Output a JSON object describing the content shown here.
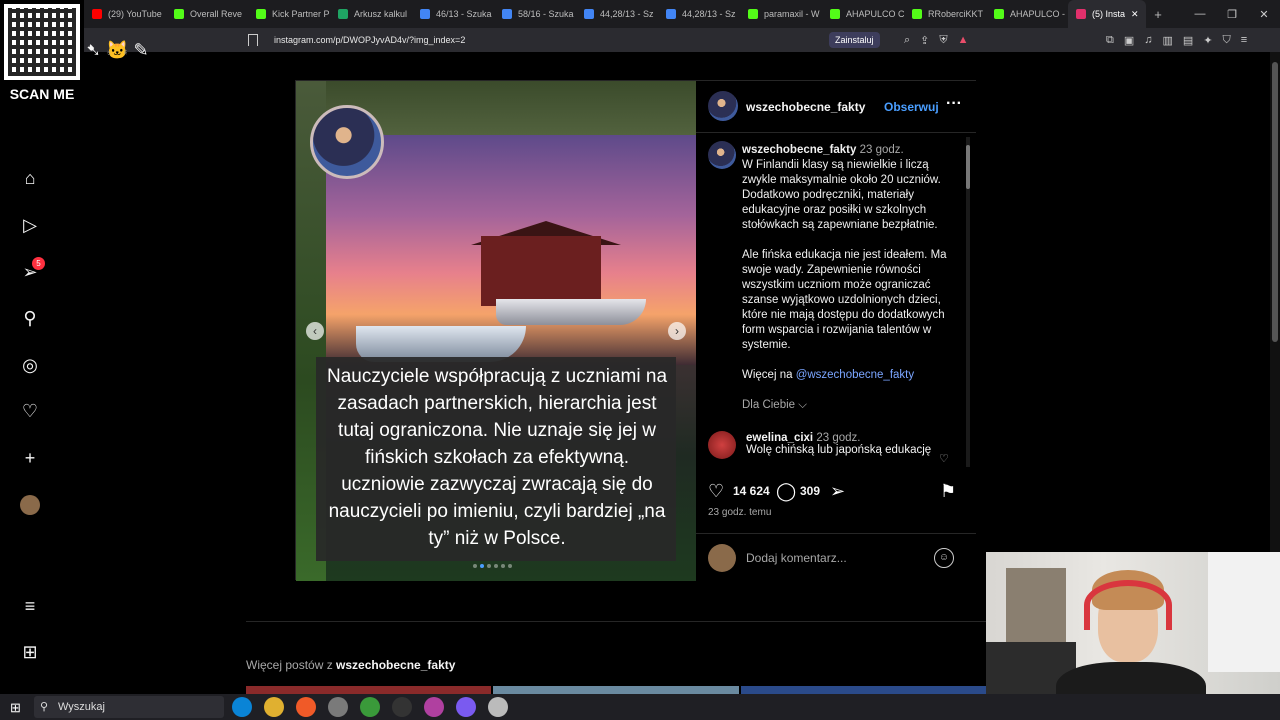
{
  "browser": {
    "tabs": [
      {
        "label": "(29) YouTube",
        "color": "#ff0000"
      },
      {
        "label": "Overall Reve",
        "color": "#53fc18"
      },
      {
        "label": "Kick Partner P",
        "color": "#53fc18"
      },
      {
        "label": "Arkusz kalkul",
        "color": "#1fa463"
      },
      {
        "label": "46/13 - Szuka",
        "color": "#4285f4"
      },
      {
        "label": "58/16 - Szuka",
        "color": "#4285f4"
      },
      {
        "label": "44,28/13 - Sz",
        "color": "#4285f4"
      },
      {
        "label": "44,28/13 - Sz",
        "color": "#4285f4"
      },
      {
        "label": "paramaxil - W",
        "color": "#53fc18"
      },
      {
        "label": "AHAPULCO C",
        "color": "#53fc18"
      },
      {
        "label": "RRoberciKKT",
        "color": "#53fc18"
      },
      {
        "label": "AHAPULCO -",
        "color": "#53fc18"
      },
      {
        "label": "(5) Insta",
        "color": "#e1306c",
        "active": true
      }
    ],
    "url": "instagram.com/p/DWOPJyvAD4v/?img_index=2",
    "install_label": "Zainstaluj"
  },
  "overlay": {
    "scan_label": "SCAN ME"
  },
  "sidebar": {
    "notification_count": "5"
  },
  "post": {
    "username": "wszechobecne_fakty",
    "follow_label": "Obserwuj",
    "image_caption": "Nauczyciele współpracują z uczniami na zasadach partnerskich, hierarchia jest tutaj ograniczona. Nie uznaje się jej w fińskich szkołach za efektywną. uczniowie zazwyczaj zwracają się do nauczycieli po imieniu, czyli bardziej „na ty” niż w Polsce.",
    "caption_time": "23 godz.",
    "caption_p1": "W Finlandii klasy są niewielkie i liczą zwykle maksymalnie około 20 uczniów. Dodatkowo podręczniki, materiały edukacyjne oraz posiłki w szkolnych stołówkach są zapewniane bezpłatnie.",
    "caption_p2": "Ale fińska edukacja nie jest ideałem. Ma swoje wady. Zapewnienie równości wszystkim uczniom może ograniczać szanse wyjątkowo uzdolnionych dzieci, które nie mają dostępu do dodatkowych form wsparcia i rozwijania talentów w systemie.",
    "more_prefix": "Więcej na ",
    "more_mention": "@wszechobecne_fakty",
    "for_you_label": "Dla Ciebie ⌵",
    "comment_user": "ewelina_cixi",
    "comment_time": "23 godz.",
    "comment_text": "Wolę chińską lub japońską edukację",
    "likes": "14 624",
    "comments_count": "309",
    "time_ago": "23 godz. temu",
    "add_comment_placeholder": "Dodaj komentarz..."
  },
  "more_posts": {
    "prefix": "Więcej postów z ",
    "username": "wszechobecne_fakty"
  },
  "taskbar": {
    "search_label": "Wyszukaj"
  }
}
